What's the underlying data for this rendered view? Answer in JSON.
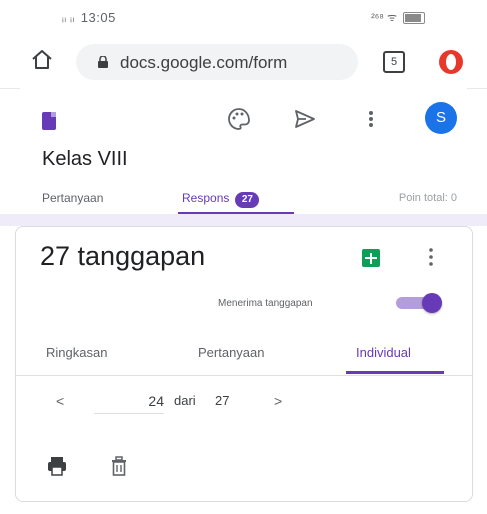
{
  "status_bar": {
    "signal": "ᵢₗ ᵢₗ",
    "time": "13:05",
    "right_info": "²⁶⁸ ᯤ"
  },
  "browser": {
    "url": "docs.google.com/form",
    "tab_count": "5"
  },
  "form_header": {
    "title": "Kelas VIII",
    "avatar_initial": "S",
    "tabs": [
      {
        "label": "Pertanyaan",
        "active": false
      },
      {
        "label": "Respons",
        "active": true,
        "badge": "27"
      }
    ],
    "points_total": "Poin total: 0"
  },
  "responses_card": {
    "title": "27 tanggapan",
    "accepting_label": "Menerima tanggapan",
    "accepting_on": true,
    "sub_tabs": [
      {
        "label": "Ringkasan",
        "active": false
      },
      {
        "label": "Pertanyaan",
        "active": false
      },
      {
        "label": "Individual",
        "active": true
      }
    ],
    "pager": {
      "prev": "<",
      "current": "24",
      "of_label": "dari",
      "total": "27",
      "next": ">"
    }
  },
  "colors": {
    "accent": "#673ab7",
    "accent_light": "#b39ddb",
    "sheets_green": "#0f9d58",
    "avatar_blue": "#1a73e8",
    "page_background": "#f0ebf8"
  },
  "icons": {
    "palette": "palette-icon",
    "send": "send-icon",
    "more": "more-vert-icon",
    "sheets": "google-sheets-icon",
    "print": "print-icon",
    "delete": "trash-icon",
    "home": "home-icon",
    "lock": "lock-icon",
    "opera": "opera-icon"
  }
}
